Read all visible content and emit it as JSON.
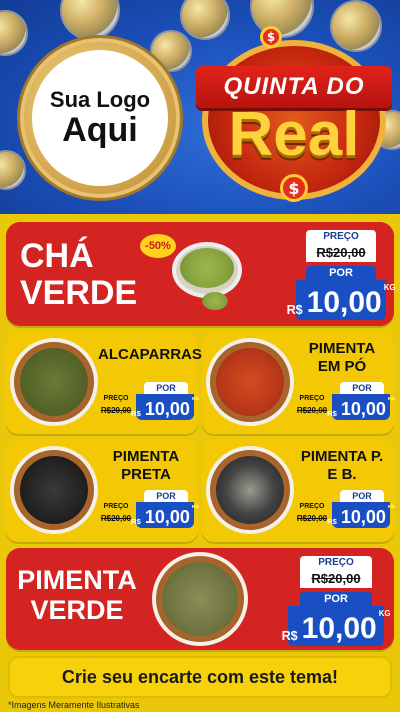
{
  "logo": {
    "line1": "Sua Logo",
    "line2": "Aqui"
  },
  "brand": {
    "top": "QUINTA DO",
    "big": "Real",
    "dollar": "$"
  },
  "products": {
    "cha": {
      "name_line1": "CHÁ",
      "name_line2": "VERDE",
      "badge": "-50%",
      "label_preco": "PREÇO",
      "old_price": "R$20,00",
      "label_por": "POR",
      "currency": "R$",
      "price": "10,00",
      "unit": "KG"
    },
    "alcaparras": {
      "name": "ALCAPARRAS",
      "label_preco": "PREÇO",
      "old_price": "R$20,00",
      "label_por": "POR",
      "currency": "R$",
      "price": "10,00",
      "unit": "KG"
    },
    "pimenta_po": {
      "name_line1": "PIMENTA",
      "name_line2": "EM PÓ",
      "label_preco": "PREÇO",
      "old_price": "R$20,00",
      "label_por": "POR",
      "currency": "R$",
      "price": "10,00",
      "unit": "KG"
    },
    "pimenta_preta": {
      "name_line1": "PIMENTA",
      "name_line2": "PRETA",
      "label_preco": "PREÇO",
      "old_price": "R$20,00",
      "label_por": "POR",
      "currency": "R$",
      "price": "10,00",
      "unit": "KG"
    },
    "pimenta_pb": {
      "name_line1": "PIMENTA P.",
      "name_line2": "E B.",
      "label_preco": "PREÇO",
      "old_price": "R$20,00",
      "label_por": "POR",
      "currency": "R$",
      "price": "10,00",
      "unit": "KG"
    },
    "pimenta_verde": {
      "name_line1": "PIMENTA",
      "name_line2": "VERDE",
      "label_preco": "PREÇO",
      "old_price": "R$20,00",
      "label_por": "POR",
      "currency": "R$",
      "price": "10,00",
      "unit": "KG"
    }
  },
  "footer": {
    "cta": "Crie seu encarte com este tema!",
    "disclaimer": "*Imagens Meramente Ilustrativas"
  },
  "colors": {
    "red": "#d32421",
    "yellow": "#f3c905",
    "blue": "#1a4fc4"
  }
}
